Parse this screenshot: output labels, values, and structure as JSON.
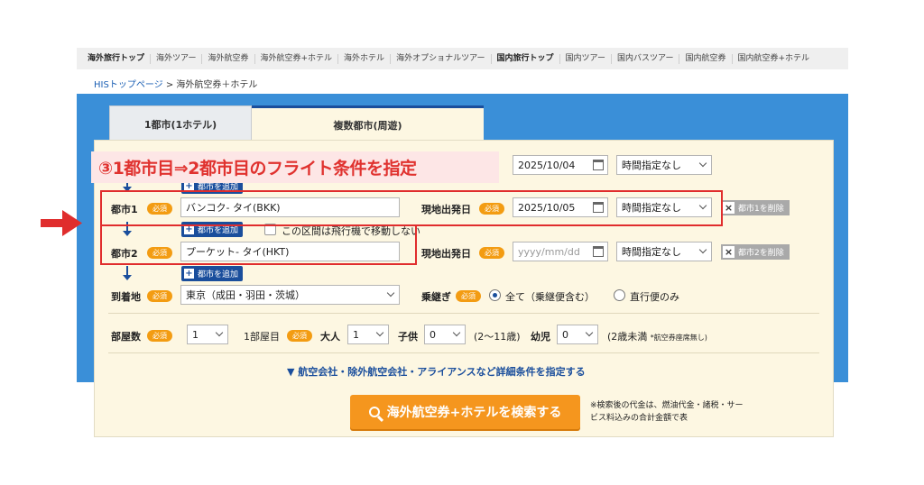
{
  "topnav": {
    "items": [
      {
        "label": "海外旅行トップ",
        "bold": true
      },
      {
        "label": "海外ツアー",
        "bold": false
      },
      {
        "label": "海外航空券",
        "bold": false
      },
      {
        "label": "海外航空券+ホテル",
        "bold": false
      },
      {
        "label": "海外ホテル",
        "bold": false
      },
      {
        "label": "海外オプショナルツアー",
        "bold": false
      },
      {
        "label": "国内旅行トップ",
        "bold": true
      },
      {
        "label": "国内ツアー",
        "bold": false
      },
      {
        "label": "国内バスツアー",
        "bold": false
      },
      {
        "label": "国内航空券",
        "bold": false
      },
      {
        "label": "国内航空券+ホテル",
        "bold": false
      }
    ]
  },
  "breadcrumb": {
    "home": "HISトップページ",
    "separator": ">",
    "current": "海外航空券＋ホテル"
  },
  "tabs": {
    "single": "1都市(1ホテル)",
    "multi": "複数都市(周遊)"
  },
  "annotation": {
    "text": "③1都市目⇒2都市目のフライト条件を指定"
  },
  "required_badge": "必須",
  "origin": {
    "date": "2025/10/04",
    "time": "時間指定なし",
    "add_city": "都市を追加"
  },
  "city1": {
    "label": "都市1",
    "value": "バンコク- タイ(BKK)",
    "date_label": "現地出発日",
    "date": "2025/10/05",
    "time": "時間指定なし",
    "delete": "都市1を削除",
    "add_city": "都市を追加",
    "no_flight": "この区間は飛行機で移動しない"
  },
  "city2": {
    "label": "都市2",
    "value": "プーケット- タイ(HKT)",
    "date_label": "現地出発日",
    "date_placeholder": "yyyy/mm/dd",
    "time": "時間指定なし",
    "delete": "都市2を削除",
    "add_city": "都市を追加"
  },
  "arrival": {
    "label": "到着地",
    "value": "東京（成田・羽田・茨城）",
    "transfer_label": "乗継ぎ",
    "opt_all": "全て（乗継便含む）",
    "opt_direct": "直行便のみ"
  },
  "rooms": {
    "label": "部屋数",
    "count": "1",
    "room1": "1部屋目",
    "adult_label": "大人",
    "adult": "1",
    "child_label": "子供",
    "child": "0",
    "child_range": "(2〜11歳)",
    "infant_label": "幼児",
    "infant": "0",
    "infant_range": "(2歳未満",
    "infant_note": "*航空券座席無し)"
  },
  "detail_link": "▼ 航空会社・除外航空会社・アライアンスなど詳細条件を指定する",
  "search_button": "海外航空券+ホテルを検索する",
  "note": "※検索後の代金は、燃油代金・諸税・サービス料込みの合計金額で表",
  "colors": {
    "accent": "#1a4e9c",
    "annotation": "#e02d2d",
    "search": "#f5961e",
    "band": "#3a8fd8"
  }
}
